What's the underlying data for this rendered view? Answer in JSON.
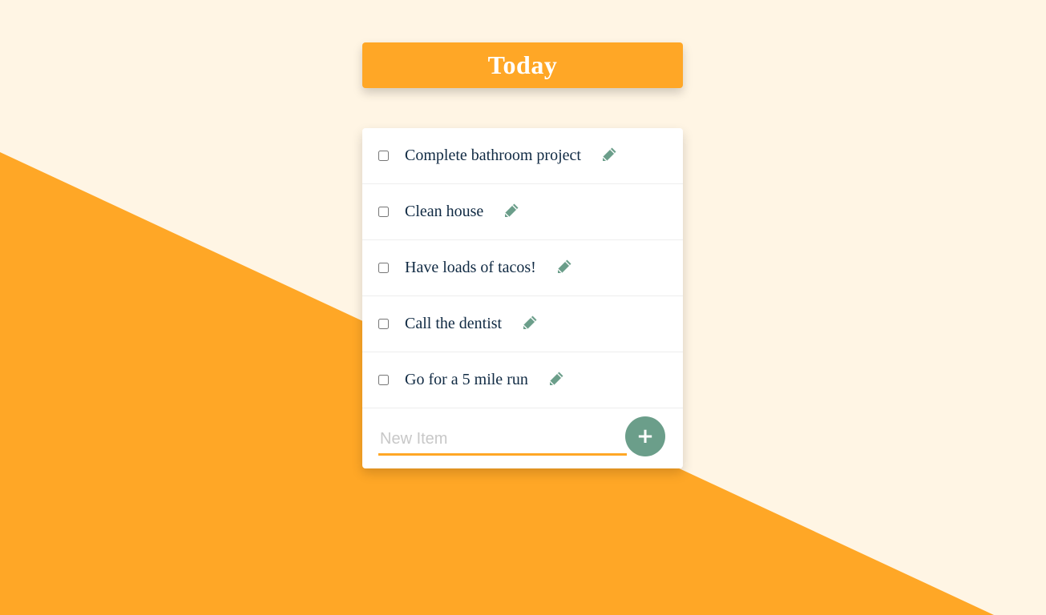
{
  "app": {
    "title": "Today"
  },
  "todo": {
    "items": [
      {
        "label": "Complete bathroom project",
        "checked": false
      },
      {
        "label": "Clean house",
        "checked": false
      },
      {
        "label": "Have loads of tacos!",
        "checked": false
      },
      {
        "label": "Call the dentist",
        "checked": false
      },
      {
        "label": "Go for a 5 mile run",
        "checked": false
      }
    ],
    "edit_icon": "pencil-icon",
    "new_item": {
      "placeholder": "New Item",
      "value": ""
    },
    "add_button_label": "+"
  },
  "colors": {
    "background": "#FFF5E4",
    "accent": "#FFA726",
    "button": "#6B9E8A",
    "icon": "#6B9E8A",
    "text": "#102A43"
  }
}
